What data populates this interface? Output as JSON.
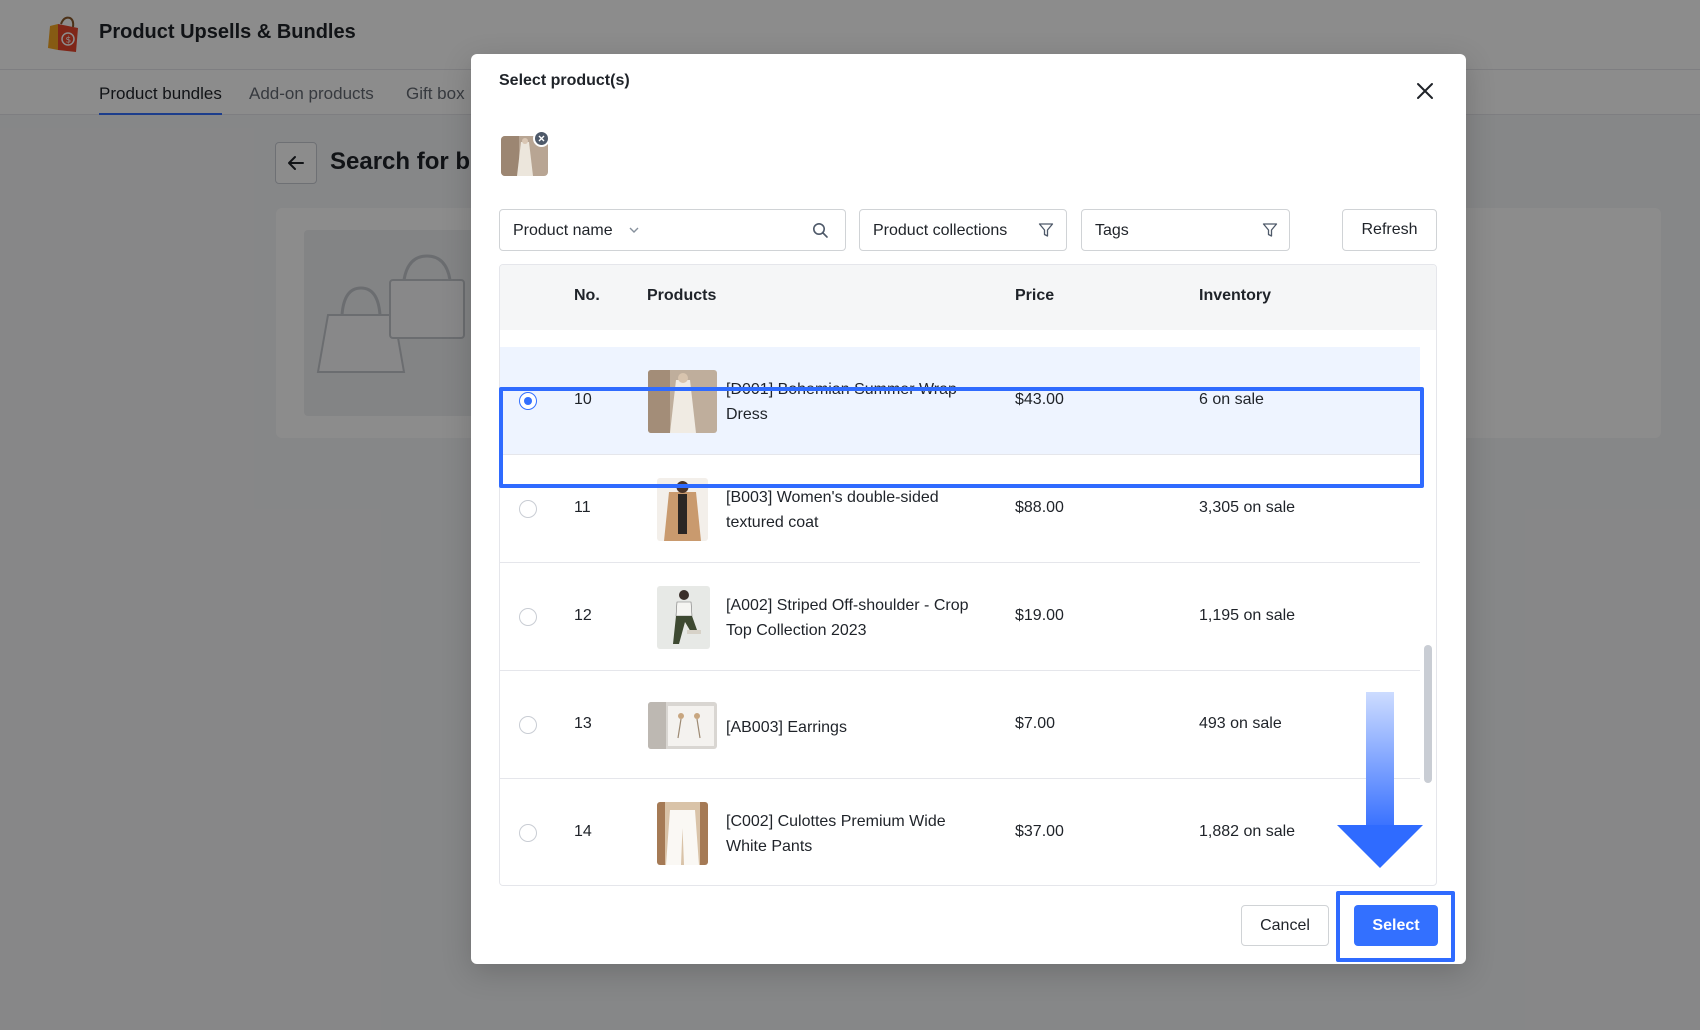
{
  "app": {
    "title": "Product Upsells & Bundles",
    "tabs": [
      {
        "label": "Product bundles",
        "active": true
      },
      {
        "label": "Add-on products",
        "active": false
      },
      {
        "label": "Gift box",
        "active": false
      }
    ],
    "page_heading": "Search for bu"
  },
  "modal": {
    "title": "Select product(s)",
    "filters": {
      "field_select": "Product name",
      "search_value": "",
      "collections": "Product collections",
      "tags": "Tags",
      "refresh_label": "Refresh"
    },
    "table": {
      "columns": [
        "No.",
        "Products",
        "Price",
        "Inventory"
      ],
      "rows": [
        {
          "no": "10",
          "name": "[D001] Bohemian Summer Wrap Dress",
          "price": "$43.00",
          "inventory": "6 on sale",
          "selected": true
        },
        {
          "no": "11",
          "name": "[B003] Women's double-sided textured coat",
          "price": "$88.00",
          "inventory": "3,305 on sale",
          "selected": false
        },
        {
          "no": "12",
          "name": "[A002] Striped Off-shoulder - Crop Top Collection 2023",
          "price": "$19.00",
          "inventory": "1,195 on sale",
          "selected": false
        },
        {
          "no": "13",
          "name": "[AB003] Earrings",
          "price": "$7.00",
          "inventory": "493 on sale",
          "selected": false
        },
        {
          "no": "14",
          "name": "[C002] Culottes Premium Wide White Pants",
          "price": "$37.00",
          "inventory": "1,882 on sale",
          "selected": false
        }
      ]
    },
    "cancel_label": "Cancel",
    "select_label": "Select"
  },
  "colors": {
    "primary": "#3370ff",
    "annotation": "#2f6bff",
    "overlay": "rgba(0,0,0,0.45)"
  },
  "icons": [
    "shopping-bag-logo-icon",
    "back-arrow-icon",
    "close-icon",
    "remove-badge-icon",
    "chevron-down-icon",
    "search-icon",
    "filter-funnel-icon",
    "down-arrow-annotation-icon"
  ]
}
